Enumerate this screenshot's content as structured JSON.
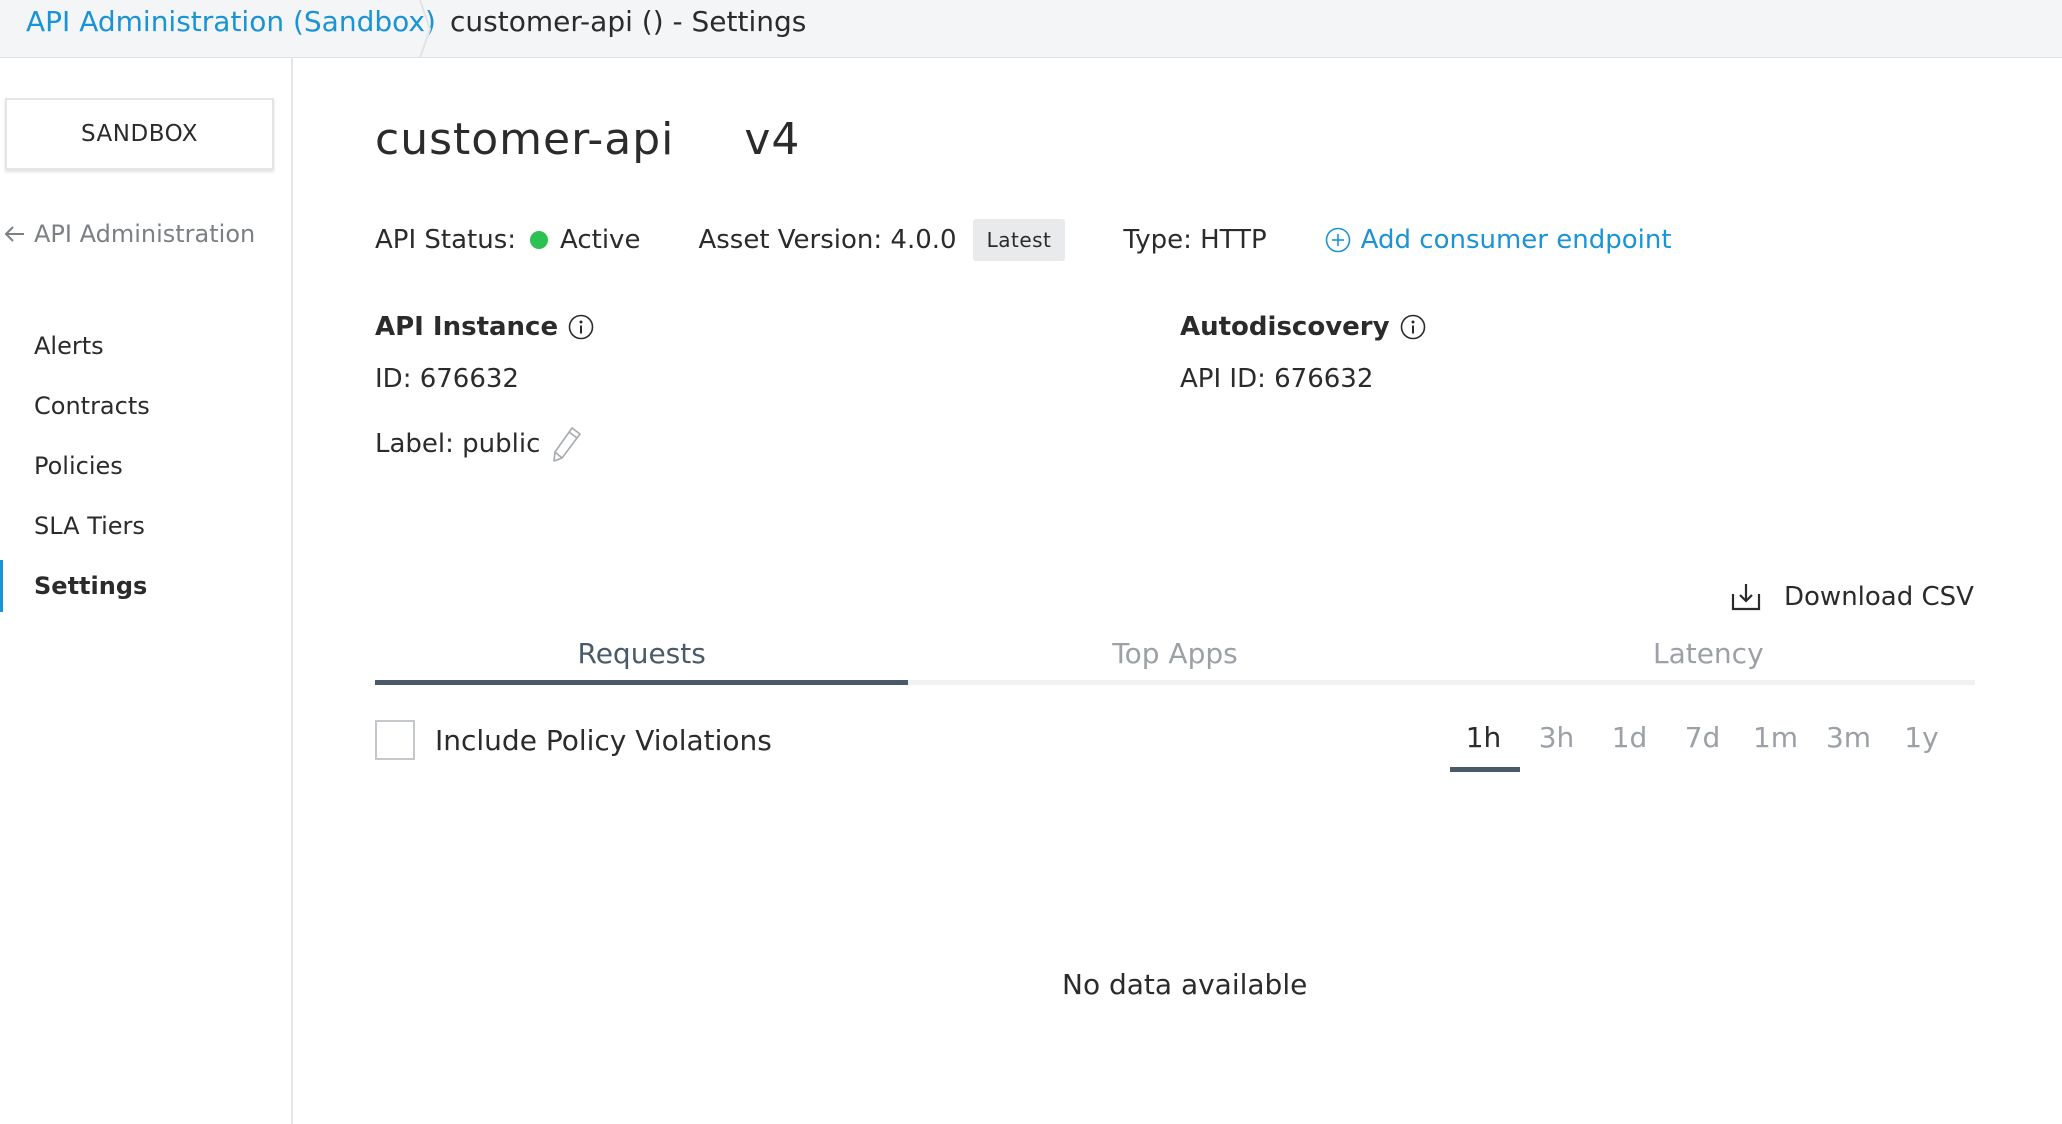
{
  "breadcrumb": {
    "link": "API Administration (Sandbox)",
    "current": "customer-api () - Settings"
  },
  "sidebar": {
    "environment": "SANDBOX",
    "back_label": "API Administration",
    "items": [
      {
        "label": "Alerts"
      },
      {
        "label": "Contracts"
      },
      {
        "label": "Policies"
      },
      {
        "label": "SLA Tiers"
      },
      {
        "label": "Settings"
      }
    ],
    "active_item": "Settings"
  },
  "header": {
    "api_name": "customer-api",
    "version": "v4"
  },
  "status": {
    "status_label": "API Status:",
    "status_value": "Active",
    "status_color": "#2bc153",
    "asset_version_label": "Asset Version: 4.0.0",
    "badge": "Latest",
    "type_label": "Type: HTTP",
    "add_endpoint": "Add consumer endpoint"
  },
  "api_instance": {
    "title": "API Instance",
    "id": "ID: 676632",
    "label": "Label: public"
  },
  "autodiscovery": {
    "title": "Autodiscovery",
    "api_id": "API ID: 676632"
  },
  "analytics": {
    "download": "Download CSV",
    "tabs": [
      {
        "label": "Requests"
      },
      {
        "label": "Top Apps"
      },
      {
        "label": "Latency"
      }
    ],
    "active_tab": "Requests",
    "include_violations": "Include Policy Violations",
    "ranges": [
      "1h",
      "3h",
      "1d",
      "7d",
      "1m",
      "3m",
      "1y"
    ],
    "active_range": "1h",
    "empty_message": "No data available"
  },
  "colors": {
    "accent": "#1a94d6",
    "tab_active": "#4a5a69",
    "status_active": "#2bc153"
  }
}
